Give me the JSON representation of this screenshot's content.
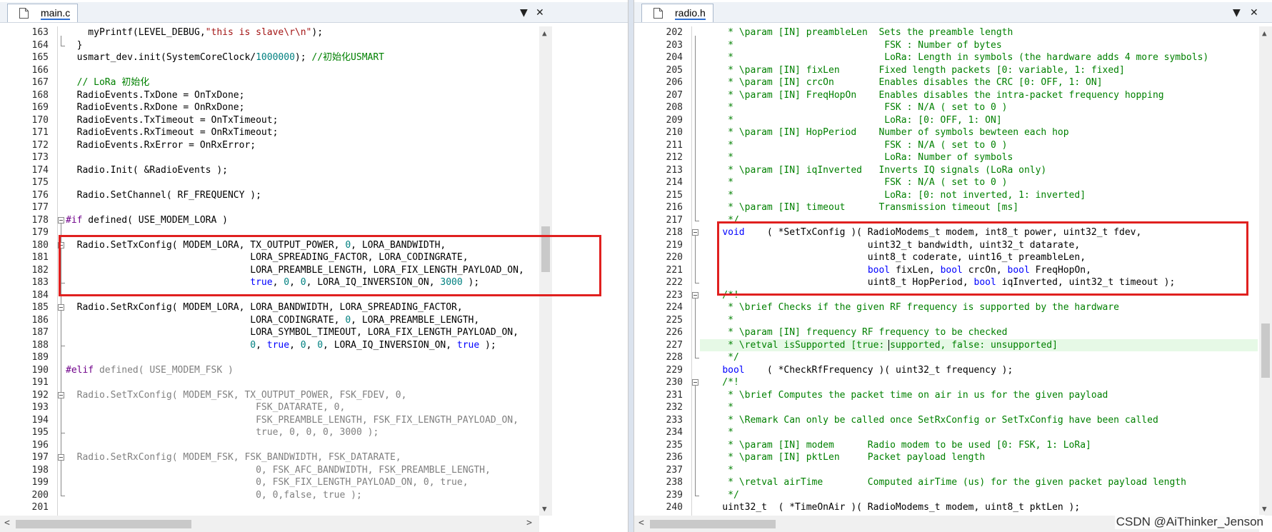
{
  "colors": {
    "keyword": "#0000ff",
    "string": "#a31515",
    "number": "#008080",
    "comment": "#008000",
    "preprocessor": "#6f008a",
    "inactive": "#808080",
    "highlight": "#e6f9e6",
    "redbox": "#e0201f"
  },
  "left": {
    "tab_label": "main.c",
    "tab_icon": "c-file-icon",
    "lines": [
      {
        "n": "163",
        "parts": [
          [
            "t",
            "    myPrintf(LEVEL_DEBUG,"
          ],
          [
            "s",
            "\"this is slave\\r\\n\""
          ],
          [
            "t",
            ");"
          ]
        ]
      },
      {
        "n": "164",
        "parts": [
          [
            "t",
            "  }"
          ]
        ]
      },
      {
        "n": "165",
        "parts": [
          [
            "t",
            "  usmart_dev.init(SystemCoreClock/"
          ],
          [
            "n",
            "1000000"
          ],
          [
            "t",
            "); "
          ],
          [
            "c",
            "//初始化USMART"
          ]
        ]
      },
      {
        "n": "166",
        "parts": [
          [
            "t",
            ""
          ]
        ]
      },
      {
        "n": "167",
        "parts": [
          [
            "c",
            "  // LoRa 初始化"
          ]
        ]
      },
      {
        "n": "168",
        "parts": [
          [
            "t",
            "  RadioEvents.TxDone = OnTxDone;"
          ]
        ]
      },
      {
        "n": "169",
        "parts": [
          [
            "t",
            "  RadioEvents.RxDone = OnRxDone;"
          ]
        ]
      },
      {
        "n": "170",
        "parts": [
          [
            "t",
            "  RadioEvents.TxTimeout = OnTxTimeout;"
          ]
        ]
      },
      {
        "n": "171",
        "parts": [
          [
            "t",
            "  RadioEvents.RxTimeout = OnRxTimeout;"
          ]
        ]
      },
      {
        "n": "172",
        "parts": [
          [
            "t",
            "  RadioEvents.RxError = OnRxError;"
          ]
        ]
      },
      {
        "n": "173",
        "parts": [
          [
            "t",
            ""
          ]
        ]
      },
      {
        "n": "174",
        "parts": [
          [
            "t",
            "  Radio.Init( &RadioEvents );"
          ]
        ]
      },
      {
        "n": "175",
        "parts": [
          [
            "t",
            ""
          ]
        ]
      },
      {
        "n": "176",
        "parts": [
          [
            "t",
            "  Radio.SetChannel( RF_FREQUENCY );"
          ]
        ]
      },
      {
        "n": "177",
        "parts": [
          [
            "t",
            ""
          ]
        ]
      },
      {
        "n": "178",
        "parts": [
          [
            "p",
            "#if"
          ],
          [
            "t",
            " defined( USE_MODEM_LORA )"
          ]
        ]
      },
      {
        "n": "179",
        "parts": [
          [
            "t",
            ""
          ]
        ]
      },
      {
        "n": "180",
        "parts": [
          [
            "t",
            "  Radio.SetTxConfig( MODEM_LORA, TX_OUTPUT_POWER, "
          ],
          [
            "n",
            "0"
          ],
          [
            "t",
            ", LORA_BANDWIDTH,"
          ]
        ]
      },
      {
        "n": "181",
        "parts": [
          [
            "t",
            "                                 LORA_SPREADING_FACTOR, LORA_CODINGRATE,"
          ]
        ]
      },
      {
        "n": "182",
        "parts": [
          [
            "t",
            "                                 LORA_PREAMBLE_LENGTH, LORA_FIX_LENGTH_PAYLOAD_ON,"
          ]
        ]
      },
      {
        "n": "183",
        "parts": [
          [
            "t",
            "                                 "
          ],
          [
            "k",
            "true"
          ],
          [
            "t",
            ", "
          ],
          [
            "n",
            "0"
          ],
          [
            "t",
            ", "
          ],
          [
            "n",
            "0"
          ],
          [
            "t",
            ", LORA_IQ_INVERSION_ON, "
          ],
          [
            "n",
            "3000"
          ],
          [
            "t",
            " );"
          ]
        ]
      },
      {
        "n": "184",
        "parts": [
          [
            "t",
            ""
          ]
        ]
      },
      {
        "n": "185",
        "parts": [
          [
            "t",
            "  Radio.SetRxConfig( MODEM_LORA, LORA_BANDWIDTH, LORA_SPREADING_FACTOR,"
          ]
        ]
      },
      {
        "n": "186",
        "parts": [
          [
            "t",
            "                                 LORA_CODINGRATE, "
          ],
          [
            "n",
            "0"
          ],
          [
            "t",
            ", LORA_PREAMBLE_LENGTH,"
          ]
        ]
      },
      {
        "n": "187",
        "parts": [
          [
            "t",
            "                                 LORA_SYMBOL_TIMEOUT, LORA_FIX_LENGTH_PAYLOAD_ON,"
          ]
        ]
      },
      {
        "n": "188",
        "parts": [
          [
            "t",
            "                                 "
          ],
          [
            "n",
            "0"
          ],
          [
            "t",
            ", "
          ],
          [
            "k",
            "true"
          ],
          [
            "t",
            ", "
          ],
          [
            "n",
            "0"
          ],
          [
            "t",
            ", "
          ],
          [
            "n",
            "0"
          ],
          [
            "t",
            ", LORA_IQ_INVERSION_ON, "
          ],
          [
            "k",
            "true"
          ],
          [
            "t",
            " );"
          ]
        ]
      },
      {
        "n": "189",
        "parts": [
          [
            "t",
            ""
          ]
        ]
      },
      {
        "n": "190",
        "parts": [
          [
            "p",
            "#elif"
          ],
          [
            "g",
            " defined( USE_MODEM_FSK )"
          ]
        ]
      },
      {
        "n": "191",
        "parts": [
          [
            "t",
            ""
          ]
        ]
      },
      {
        "n": "192",
        "parts": [
          [
            "g",
            "  Radio.SetTxConfig( MODEM_FSK, TX_OUTPUT_POWER, FSK_FDEV, 0,"
          ]
        ]
      },
      {
        "n": "193",
        "parts": [
          [
            "g",
            "                                  FSK_DATARATE, 0,"
          ]
        ]
      },
      {
        "n": "194",
        "parts": [
          [
            "g",
            "                                  FSK_PREAMBLE_LENGTH, FSK_FIX_LENGTH_PAYLOAD_ON,"
          ]
        ]
      },
      {
        "n": "195",
        "parts": [
          [
            "g",
            "                                  true, 0, 0, 0, 3000 );"
          ]
        ]
      },
      {
        "n": "196",
        "parts": [
          [
            "t",
            ""
          ]
        ]
      },
      {
        "n": "197",
        "parts": [
          [
            "g",
            "  Radio.SetRxConfig( MODEM_FSK, FSK_BANDWIDTH, FSK_DATARATE,"
          ]
        ]
      },
      {
        "n": "198",
        "parts": [
          [
            "g",
            "                                  0, FSK_AFC_BANDWIDTH, FSK_PREAMBLE_LENGTH,"
          ]
        ]
      },
      {
        "n": "199",
        "parts": [
          [
            "g",
            "                                  0, FSK_FIX_LENGTH_PAYLOAD_ON, 0, true,"
          ]
        ]
      },
      {
        "n": "200",
        "parts": [
          [
            "g",
            "                                  0, 0,false, true );"
          ]
        ]
      },
      {
        "n": "201",
        "parts": [
          [
            "t",
            ""
          ]
        ]
      }
    ]
  },
  "right": {
    "tab_label": "radio.h",
    "tab_icon": "h-file-icon",
    "lines": [
      {
        "n": "202",
        "parts": [
          [
            "c",
            "     * \\param [IN] preambleLen  Sets the preamble length"
          ]
        ]
      },
      {
        "n": "203",
        "parts": [
          [
            "c",
            "     *                           FSK : Number of bytes"
          ]
        ]
      },
      {
        "n": "204",
        "parts": [
          [
            "c",
            "     *                           LoRa: Length in symbols (the hardware adds 4 more symbols)"
          ]
        ]
      },
      {
        "n": "205",
        "parts": [
          [
            "c",
            "     * \\param [IN] fixLen       Fixed length packets [0: variable, 1: fixed]"
          ]
        ]
      },
      {
        "n": "206",
        "parts": [
          [
            "c",
            "     * \\param [IN] crcOn        Enables disables the CRC [0: OFF, 1: ON]"
          ]
        ]
      },
      {
        "n": "207",
        "parts": [
          [
            "c",
            "     * \\param [IN] FreqHopOn    Enables disables the intra-packet frequency hopping"
          ]
        ]
      },
      {
        "n": "208",
        "parts": [
          [
            "c",
            "     *                           FSK : N/A ( set to 0 )"
          ]
        ]
      },
      {
        "n": "209",
        "parts": [
          [
            "c",
            "     *                           LoRa: [0: OFF, 1: ON]"
          ]
        ]
      },
      {
        "n": "210",
        "parts": [
          [
            "c",
            "     * \\param [IN] HopPeriod    Number of symbols bewteen each hop"
          ]
        ]
      },
      {
        "n": "211",
        "parts": [
          [
            "c",
            "     *                           FSK : N/A ( set to 0 )"
          ]
        ]
      },
      {
        "n": "212",
        "parts": [
          [
            "c",
            "     *                           LoRa: Number of symbols"
          ]
        ]
      },
      {
        "n": "213",
        "parts": [
          [
            "c",
            "     * \\param [IN] iqInverted   Inverts IQ signals (LoRa only)"
          ]
        ]
      },
      {
        "n": "214",
        "parts": [
          [
            "c",
            "     *                           FSK : N/A ( set to 0 )"
          ]
        ]
      },
      {
        "n": "215",
        "parts": [
          [
            "c",
            "     *                           LoRa: [0: not inverted, 1: inverted]"
          ]
        ]
      },
      {
        "n": "216",
        "parts": [
          [
            "c",
            "     * \\param [IN] timeout      Transmission timeout [ms]"
          ]
        ]
      },
      {
        "n": "217",
        "parts": [
          [
            "c",
            "     */"
          ]
        ]
      },
      {
        "n": "218",
        "parts": [
          [
            "t",
            "    "
          ],
          [
            "k",
            "void"
          ],
          [
            "t",
            "    ( *SetTxConfig )( RadioModems_t modem, int8_t power, uint32_t fdev,"
          ]
        ]
      },
      {
        "n": "219",
        "parts": [
          [
            "t",
            "                              uint32_t bandwidth, uint32_t datarate,"
          ]
        ]
      },
      {
        "n": "220",
        "parts": [
          [
            "t",
            "                              uint8_t coderate, uint16_t preambleLen,"
          ]
        ]
      },
      {
        "n": "221",
        "parts": [
          [
            "t",
            "                              "
          ],
          [
            "k",
            "bool"
          ],
          [
            "t",
            " fixLen, "
          ],
          [
            "k",
            "bool"
          ],
          [
            "t",
            " crcOn, "
          ],
          [
            "k",
            "bool"
          ],
          [
            "t",
            " FreqHopOn,"
          ]
        ]
      },
      {
        "n": "222",
        "parts": [
          [
            "t",
            "                              uint8_t HopPeriod, "
          ],
          [
            "k",
            "bool"
          ],
          [
            "t",
            " iqInverted, uint32_t timeout );"
          ]
        ]
      },
      {
        "n": "223",
        "parts": [
          [
            "c",
            "    /*!"
          ]
        ]
      },
      {
        "n": "224",
        "parts": [
          [
            "c",
            "     * \\brief Checks if the given RF frequency is supported by the hardware"
          ]
        ]
      },
      {
        "n": "225",
        "parts": [
          [
            "c",
            "     *"
          ]
        ]
      },
      {
        "n": "226",
        "parts": [
          [
            "c",
            "     * \\param [IN] frequency RF frequency to be checked"
          ]
        ]
      },
      {
        "n": "227",
        "parts": [
          [
            "c",
            "     * \\retval isSupported [true: supported, false: unsupported]"
          ]
        ]
      },
      {
        "n": "228",
        "parts": [
          [
            "c",
            "     */"
          ]
        ]
      },
      {
        "n": "229",
        "parts": [
          [
            "t",
            "    "
          ],
          [
            "k",
            "bool"
          ],
          [
            "t",
            "    ( *CheckRfFrequency )( uint32_t frequency );"
          ]
        ]
      },
      {
        "n": "230",
        "parts": [
          [
            "c",
            "    /*!"
          ]
        ]
      },
      {
        "n": "231",
        "parts": [
          [
            "c",
            "     * \\brief Computes the packet time on air in us for the given payload"
          ]
        ]
      },
      {
        "n": "232",
        "parts": [
          [
            "c",
            "     *"
          ]
        ]
      },
      {
        "n": "233",
        "parts": [
          [
            "c",
            "     * \\Remark Can only be called once SetRxConfig or SetTxConfig have been called"
          ]
        ]
      },
      {
        "n": "234",
        "parts": [
          [
            "c",
            "     *"
          ]
        ]
      },
      {
        "n": "235",
        "parts": [
          [
            "c",
            "     * \\param [IN] modem      Radio modem to be used [0: FSK, 1: LoRa]"
          ]
        ]
      },
      {
        "n": "236",
        "parts": [
          [
            "c",
            "     * \\param [IN] pktLen     Packet payload length"
          ]
        ]
      },
      {
        "n": "237",
        "parts": [
          [
            "c",
            "     *"
          ]
        ]
      },
      {
        "n": "238",
        "parts": [
          [
            "c",
            "     * \\retval airTime        Computed airTime (us) for the given packet payload length"
          ]
        ]
      },
      {
        "n": "239",
        "parts": [
          [
            "c",
            "     */"
          ]
        ]
      },
      {
        "n": "240",
        "parts": [
          [
            "t",
            "    uint32_t  ( *TimeOnAir )( RadioModems_t modem, uint8_t pktLen );"
          ]
        ]
      }
    ]
  },
  "controls": {
    "dropdown_glyph": "▼",
    "close_glyph": "✕",
    "arrow_up": "▲",
    "arrow_down": "▼",
    "arrow_left": "<",
    "arrow_right": ">"
  },
  "watermark": "CSDN @AiThinker_Jenson"
}
